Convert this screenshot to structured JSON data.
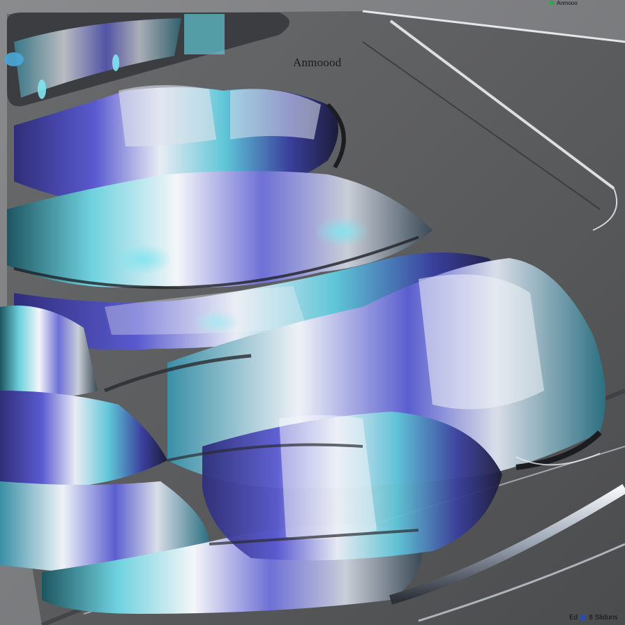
{
  "scene": {
    "label": "Anmoood",
    "top_corner_text": "Anmooo",
    "bottom_corner_left": "Ed",
    "bottom_corner_right": "8 Sliduns"
  },
  "colors": {
    "panel": "#5f6061",
    "panel_dark": "#3d3e40",
    "chrome_light": "#e9edf3",
    "accent_blue": "#5656c8",
    "accent_cyan": "#4cc2d6",
    "edge_highlight": "#f2f4f6"
  }
}
